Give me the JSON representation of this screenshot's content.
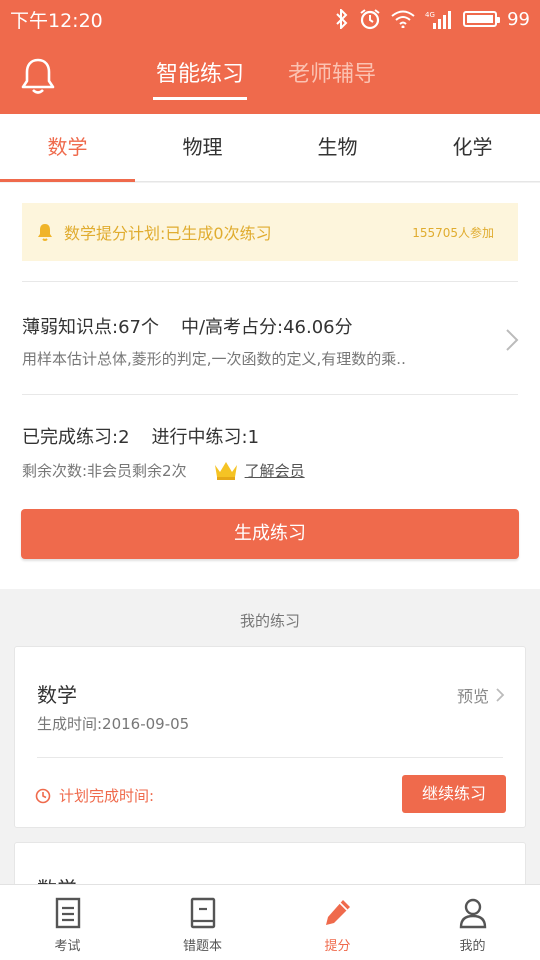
{
  "status_bar": {
    "time": "下午12:20",
    "battery_text": "99",
    "battery_level": 0.99,
    "icons": [
      "bluetooth-icon",
      "alarm-icon",
      "wifi-icon",
      "signal-icon",
      "battery-icon"
    ]
  },
  "header": {
    "tabs": [
      {
        "label": "智能练习",
        "active": true
      },
      {
        "label": "老师辅导",
        "active": false
      }
    ]
  },
  "subject_tabs": [
    {
      "label": "数学",
      "active": true
    },
    {
      "label": "物理",
      "active": false
    },
    {
      "label": "生物",
      "active": false
    },
    {
      "label": "化学",
      "active": false
    }
  ],
  "notice": {
    "text": "数学提分计划:已生成0次练习",
    "count": "155705人参加"
  },
  "weak_points": {
    "count_label": "薄弱知识点:67个",
    "score_label": "中/高考占分:46.06分",
    "description": "用样本估计总体,菱形的判定,一次函数的定义,有理数的乘.."
  },
  "progress": {
    "completed": "已完成练习:2",
    "in_progress": "进行中练习:1",
    "remaining": "剩余次数:非会员剩余2次",
    "member_link": "了解会员"
  },
  "generate_button": "生成练习",
  "my_exercises": {
    "section_title": "我的练习",
    "items": [
      {
        "subject": "数学",
        "preview": "预览",
        "created": "生成时间:2016-09-05",
        "plan": "计划完成时间:",
        "action": "继续练习"
      },
      {
        "subject": "数学"
      }
    ]
  },
  "bottom_nav": [
    {
      "label": "考试",
      "icon": "exam-icon",
      "active": false
    },
    {
      "label": "错题本",
      "icon": "book-icon",
      "active": false
    },
    {
      "label": "提分",
      "icon": "pencil-icon",
      "active": true
    },
    {
      "label": "我的",
      "icon": "user-icon",
      "active": false
    }
  ],
  "colors": {
    "accent": "#ef6a4c",
    "notice_bg": "#fdf5dc",
    "notice_text": "#e0ac2f"
  }
}
